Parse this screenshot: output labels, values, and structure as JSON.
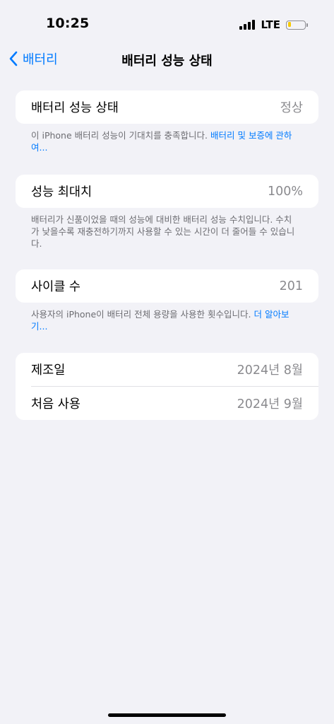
{
  "status_bar": {
    "time": "10:25",
    "network": "LTE",
    "battery_level_fraction": 0.2,
    "battery_color": "#f7c900"
  },
  "nav": {
    "back_label": "배터리",
    "title": "배터리 성능 상태",
    "accent_color": "#007aff"
  },
  "health": {
    "label": "배터리 성능 상태",
    "value": "정상",
    "footnote_text": "이 iPhone 배터리 성능이 기대치를 충족합니다. ",
    "footnote_link": "배터리 및 보증에 관하여..."
  },
  "max_capacity": {
    "label": "성능 최대치",
    "value": "100%",
    "footnote_text": "배터리가 신품이었을 때의 성능에 대비한 배터리 성능 수치입니다. 수치가 낮을수록 재충전하기까지 사용할 수 있는 시간이 더 줄어들 수 있습니다."
  },
  "cycle_count": {
    "label": "사이클 수",
    "value": "201",
    "footnote_text": "사용자의 iPhone이 배터리 전체 용량을 사용한 횟수입니다. ",
    "footnote_link": "더 알아보기..."
  },
  "dates": {
    "manufacture_label": "제조일",
    "manufacture_value": "2024년 8월",
    "first_use_label": "처음 사용",
    "first_use_value": "2024년 9월"
  }
}
